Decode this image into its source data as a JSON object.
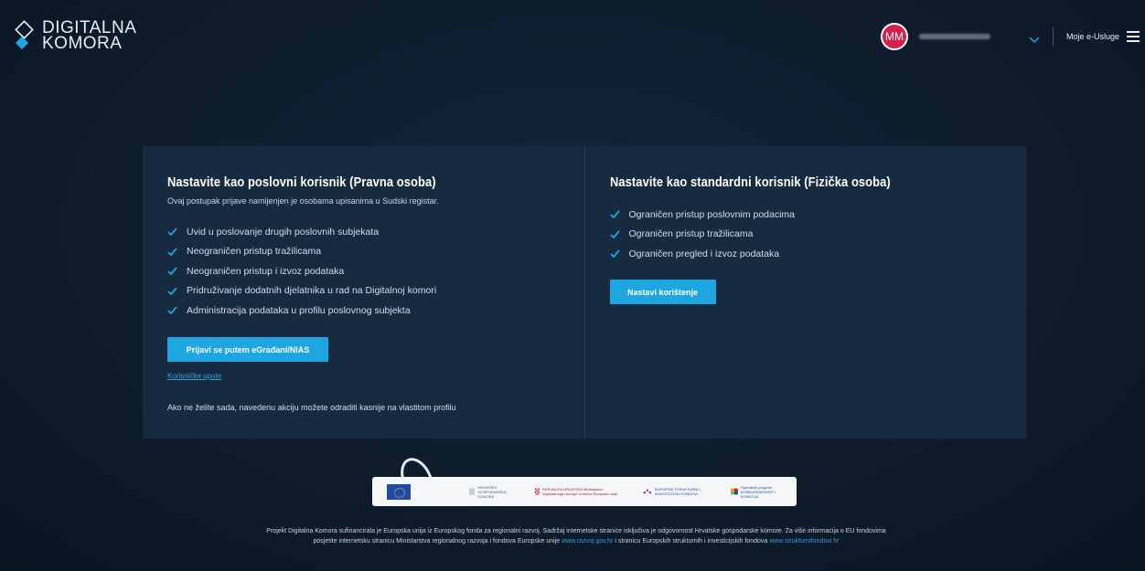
{
  "header": {
    "logo_line1": "DIGITALNA",
    "logo_line2": "KOMORA",
    "avatar_initials": "MM",
    "eusluge_label": "Moje e-Usluge",
    "menu_icon": "hamburger-icon"
  },
  "left_panel": {
    "title": "Nastavite kao poslovni korisnik (Pravna osoba)",
    "subtitle": "Ovaj postupak prijave namijenjen je osobama upisanima u Sudski registar.",
    "items": [
      "Uvid u poslovanje drugih poslovnih subjekata",
      "Neograničen pristup tražilicama",
      "Neograničen pristup i izvoz podataka",
      "Pridruživanje dodatnih djelatnika u rad na Digitalnoj komori",
      "Administracija podataka u profilu poslovnog subjekta"
    ],
    "button_label": "Prijavi se putem eGrađani/NIAS",
    "link_label": "Korisničke upute",
    "note": "Ako ne želite sada, navedenu akciju možete odraditi kasnije na vlastitom profilu"
  },
  "right_panel": {
    "title": "Nastavite kao standardni korisnik (Fizička osoba)",
    "items": [
      "Ograničen pristup poslovnim podacima",
      "Ograničen pristup tražilicama",
      "Ograničen pregled i izvoz podataka"
    ],
    "button_label": "Nastavi korištenje"
  },
  "footer": {
    "logos": {
      "eu": "Europska unija",
      "hgk": "HRVATSKA GOSPODARSKA KOMORA",
      "rh": "REPUBLIKA HRVATSKA Ministarstvo regionalnoga razvoja i fondova Europske unije",
      "esif": "EUROPSKI STRUKTURNI I INVESTICIJSKI FONDOVI",
      "op": "Operativni program KONKURENTNOST I KOHEZIJA"
    },
    "text_part1": "Projekt Digitalna Komora sufinancirala je Europska unija iz Europskog fonda za regionalni razvoj. Sadržaj internetske stranice isključiva je odgovornost Hrvatske gospodarske komore. Za više informacija o EU fondovima posjetite internetsku stranicu Ministarstva regionalnog razvoja i fondova Europske unije",
    "link1": "www.razvoj.gov.hr",
    "text_part2": "i stranicu Europskih strukturnih i investicijskih fondova",
    "link2": "www.strukturnifondovi.hr",
    "colors": {
      "accent": "#1ea6e0",
      "background": "#0f1d2e",
      "panel": "#172b40"
    }
  }
}
